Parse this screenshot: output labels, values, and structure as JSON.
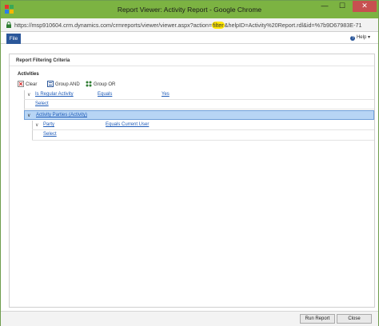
{
  "window": {
    "title": "Report Viewer: Activity Report - Google Chrome",
    "controls": {
      "minimize": "—",
      "maximize": "☐",
      "close": "✕"
    }
  },
  "address": {
    "url_before": "https://msp910604.crm.dynamics.com/crmreports/viewer/viewer.aspx?action=",
    "url_highlight": "filter",
    "url_after": "&helpID=Activity%20Report.rdl&id=%7b9D67983E-71"
  },
  "ribbon": {
    "file_label": "File",
    "help_label": "Help"
  },
  "panel": {
    "title": "Report Filtering Criteria",
    "section": "Activities",
    "toolbar": {
      "clear": "Clear",
      "group_and": "Group AND",
      "group_or": "Group OR"
    },
    "rows": [
      {
        "field": "Is Regular Activity",
        "operator": "Equals",
        "value": "Yes"
      },
      {
        "select": "Select"
      },
      {
        "related": "Activity Parties (Activity)"
      },
      {
        "field": "Party",
        "operator": "Equals Current User"
      },
      {
        "select": "Select"
      }
    ]
  },
  "footer": {
    "run_report": "Run Report",
    "close": "Close"
  },
  "colors": {
    "titlebar": "#7cb342",
    "file_tab": "#2b579a",
    "link": "#1e5bb8",
    "selection": "#b7d5f5",
    "url_highlight": "#ffe600"
  }
}
